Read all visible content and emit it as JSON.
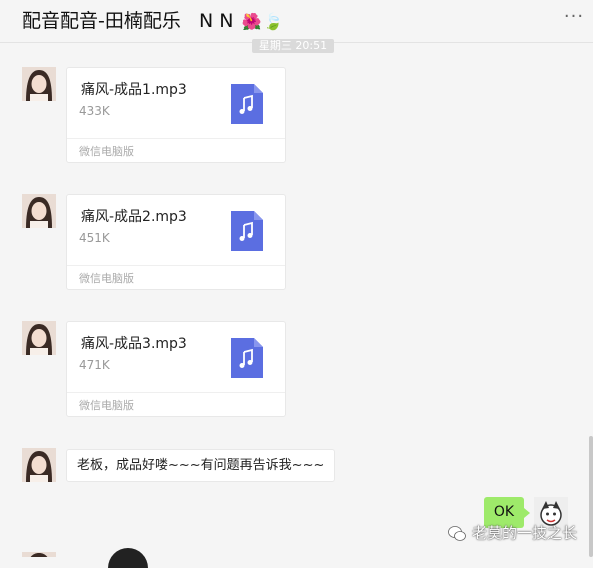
{
  "header": {
    "title": "配音配音-田楠配乐",
    "title_suffix": "N N",
    "flower_emoji": "🌺",
    "leaf_emoji": "🍃",
    "more_label": "···"
  },
  "time_divider": "星期三 20:51",
  "messages": [
    {
      "file_name": "痛风-成品1.mp3",
      "file_size": "433K",
      "source": "微信电脑版"
    },
    {
      "file_name": "痛风-成品2.mp3",
      "file_size": "451K",
      "source": "微信电脑版"
    },
    {
      "file_name": "痛风-成品3.mp3",
      "file_size": "471K",
      "source": "微信电脑版"
    }
  ],
  "text_message": "老板，成品好喽~~~有问题再告诉我~~~",
  "reply": "OK",
  "watermark": "老莫的一技之长",
  "colors": {
    "file_icon": "#5b6ee1",
    "reply_bubble": "#9eea6a",
    "background": "#f5f5f5"
  }
}
